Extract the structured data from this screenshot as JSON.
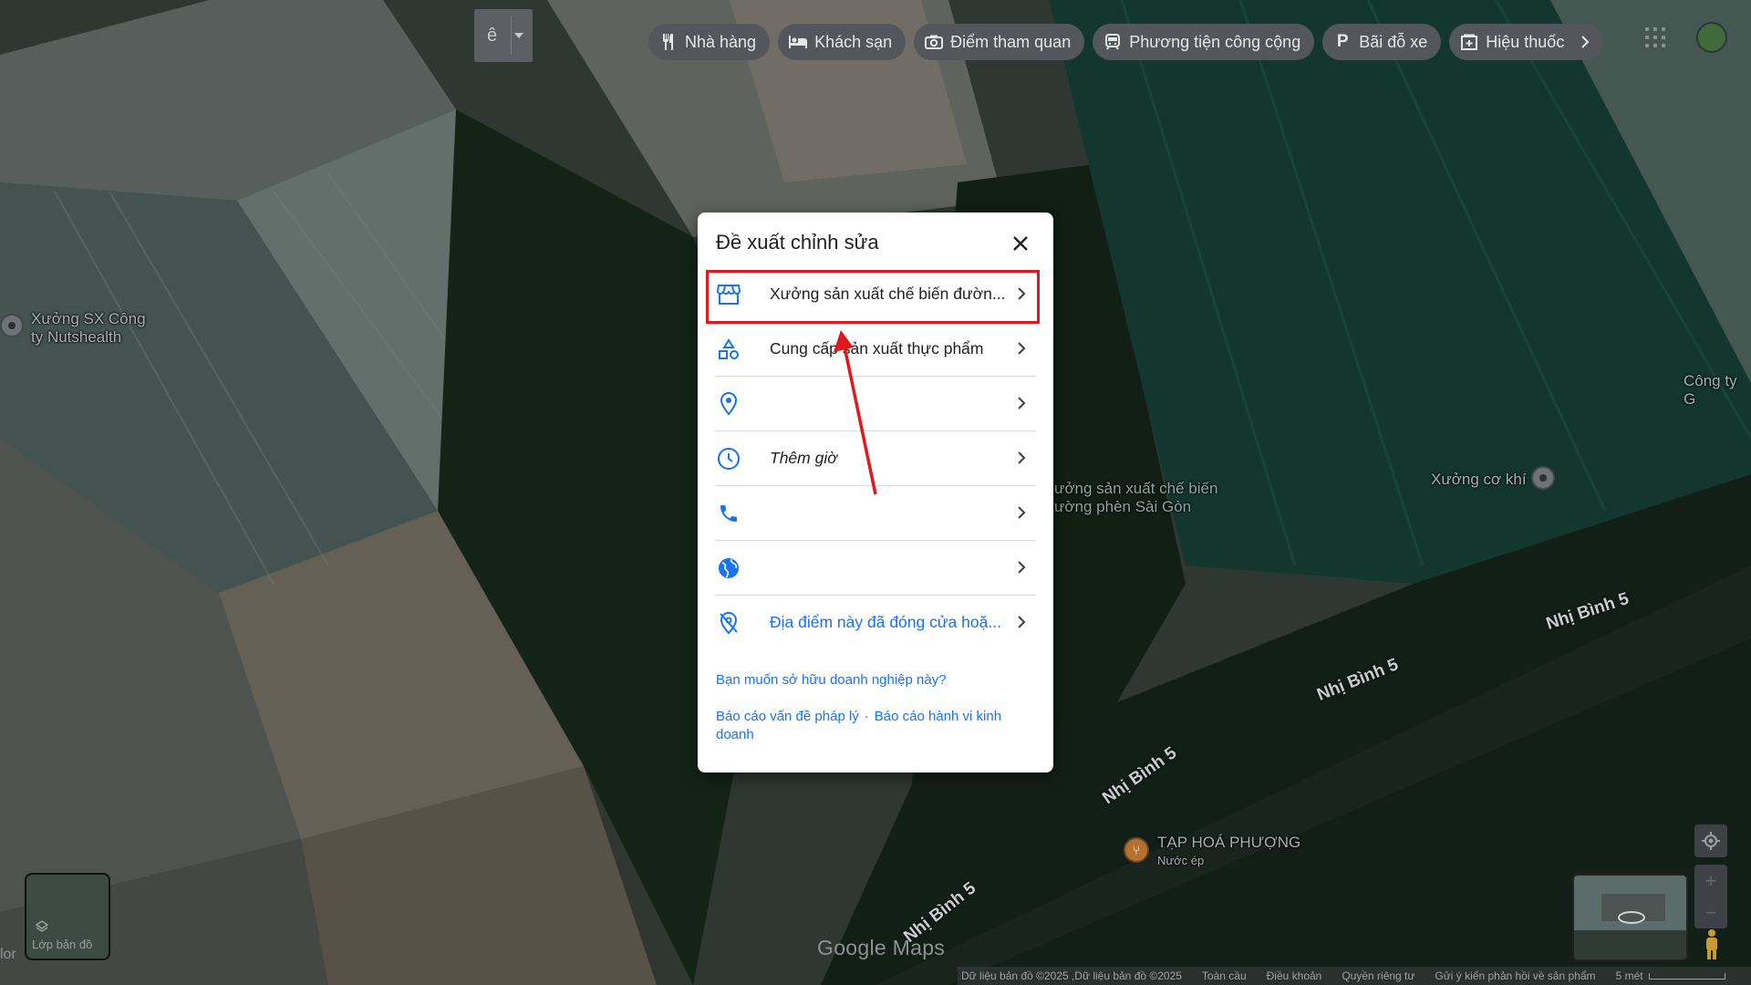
{
  "topbar": {
    "mode_letter": "ê",
    "categories": [
      {
        "label": "Nhà hàng",
        "icon": "restaurant-icon"
      },
      {
        "label": "Khách sạn",
        "icon": "hotel-icon"
      },
      {
        "label": "Điểm tham quan",
        "icon": "camera-icon"
      },
      {
        "label": "Phương tiện công cộng",
        "icon": "transit-icon"
      },
      {
        "label": "Bãi đỗ xe",
        "icon": "parking-icon"
      },
      {
        "label": "Hiệu thuốc",
        "icon": "pharmacy-icon"
      }
    ]
  },
  "map": {
    "labels": {
      "xuong_sx_line1": "Xưởng SX Công",
      "xuong_sx_line2": "ty Nutshealth",
      "cong_ty": "Công ty G",
      "xuong_co_khi": "Xưởng cơ khí",
      "duong_line1": "ưởng sản xuất chế biến",
      "duong_line2": "ường phèn Sài Gòn",
      "tap_hoa": "TẠP HOÁ PHƯỢNG",
      "tap_hoa_sub": "Nước ép"
    },
    "roads": [
      "Nhị Bình 5",
      "Nhị Bình 5",
      "Nhị Bình 5",
      "Nhị Bình 5"
    ],
    "watermark": "Google Maps",
    "layers_label": "Lớp bản đồ",
    "left_edge_text": "lor"
  },
  "bottom_bar": {
    "map_data": "Dữ liệu bản đồ ©2025 ,Dữ liệu bản đồ ©2025",
    "global": "Toàn cầu",
    "terms": "Điều khoản",
    "privacy": "Quyền riêng tư",
    "feedback": "Gửi ý kiến phản hồi về sản phẩm",
    "scale": "5 mét"
  },
  "dialog": {
    "title": "Đề xuất chỉnh sửa",
    "rows": [
      {
        "text": "Xưởng sản xuất chế biến đườn...",
        "icon": "storefront-icon",
        "style": "normal"
      },
      {
        "text": "Cung cấp sản xuất thực phẩm",
        "icon": "category-icon",
        "style": "normal"
      },
      {
        "text": "",
        "icon": "location-pin-icon",
        "style": "normal"
      },
      {
        "text": "Thêm giờ",
        "icon": "clock-icon",
        "style": "italic"
      },
      {
        "text": "",
        "icon": "phone-icon",
        "style": "normal"
      },
      {
        "text": "",
        "icon": "globe-icon",
        "style": "normal"
      },
      {
        "text": "Địa điểm này đã đóng cửa hoặ...",
        "icon": "closed-location-icon",
        "style": "blue"
      }
    ],
    "own_link": "Bạn muốn sở hữu doanh nghiệp này?",
    "report_legal": "Báo cáo vấn đề pháp lý",
    "separator": "·",
    "report_business": "Báo cáo hành vi kinh doanh"
  },
  "colors": {
    "accent_blue": "#1a73e8",
    "highlight_red": "#e0191f",
    "chip_bg": "#53575b"
  }
}
